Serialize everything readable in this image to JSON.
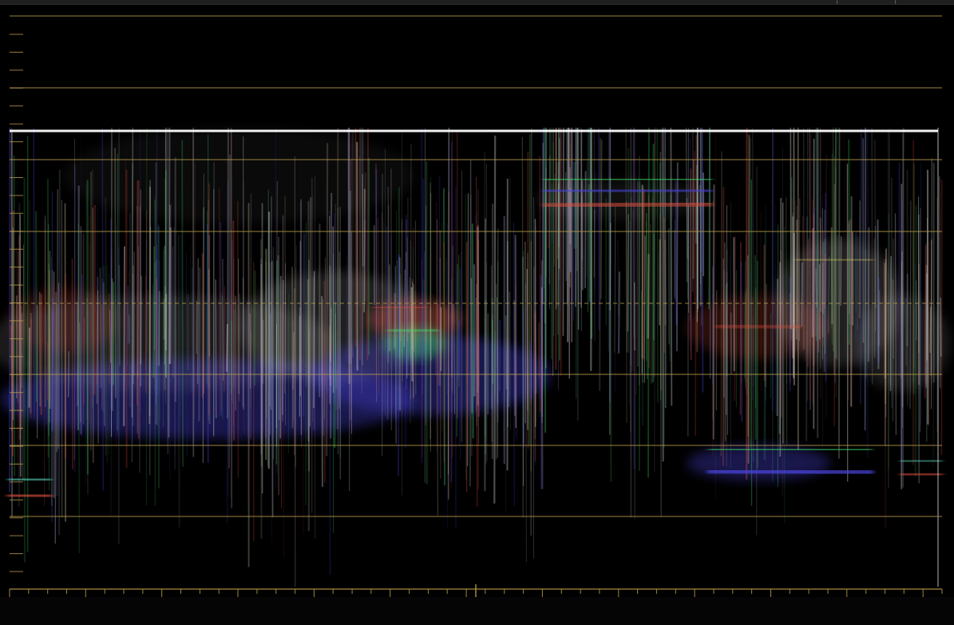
{
  "scope": {
    "type": "RGB parade waveform scope",
    "graticule_color": "#b89a4a",
    "waveform_colors": {
      "red": "#e0503f",
      "green": "#3fe06a",
      "blue": "#4a42d8",
      "white": "#ffffff"
    },
    "major_grid_lines": 8,
    "dashed_reference_line": true,
    "left_scale_ticks": 31,
    "bottom_scale_ticks": 50
  }
}
